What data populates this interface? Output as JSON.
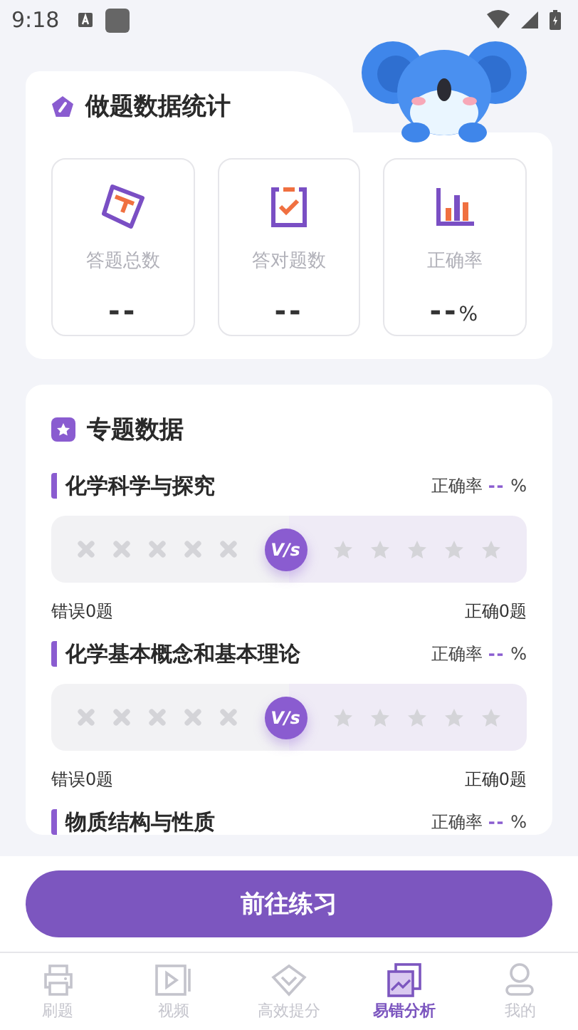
{
  "status_bar": {
    "time": "9:18"
  },
  "stats_card": {
    "title": "做题数据统计",
    "items": [
      {
        "kind": "total",
        "label": "答题总数",
        "value": "--"
      },
      {
        "kind": "correct",
        "label": "答对题数",
        "value": "--"
      },
      {
        "kind": "rate",
        "label": "正确率",
        "value": "--",
        "unit": "%"
      }
    ]
  },
  "topics_card": {
    "title": "专题数据",
    "topics": [
      {
        "name": "化学科学与探究",
        "accuracy_label": "正确率",
        "accuracy": "--",
        "unit": "%",
        "vs": "V/s",
        "wrong": "错误0题",
        "correct": "正确0题"
      },
      {
        "name": "化学基本概念和基本理论",
        "accuracy_label": "正确率",
        "accuracy": "--",
        "unit": "%",
        "vs": "V/s",
        "wrong": "错误0题",
        "correct": "正确0题"
      },
      {
        "name": "物质结构与性质",
        "accuracy_label": "正确率",
        "accuracy": "--",
        "unit": "%"
      }
    ]
  },
  "practice_button": "前往练习",
  "nav": [
    {
      "kind": "practice",
      "label": "刷题",
      "selected": false
    },
    {
      "kind": "video",
      "label": "视频",
      "selected": false
    },
    {
      "kind": "boost",
      "label": "高效提分",
      "selected": false
    },
    {
      "kind": "analysis",
      "label": "易错分析",
      "selected": true
    },
    {
      "kind": "profile",
      "label": "我的",
      "selected": false
    }
  ]
}
